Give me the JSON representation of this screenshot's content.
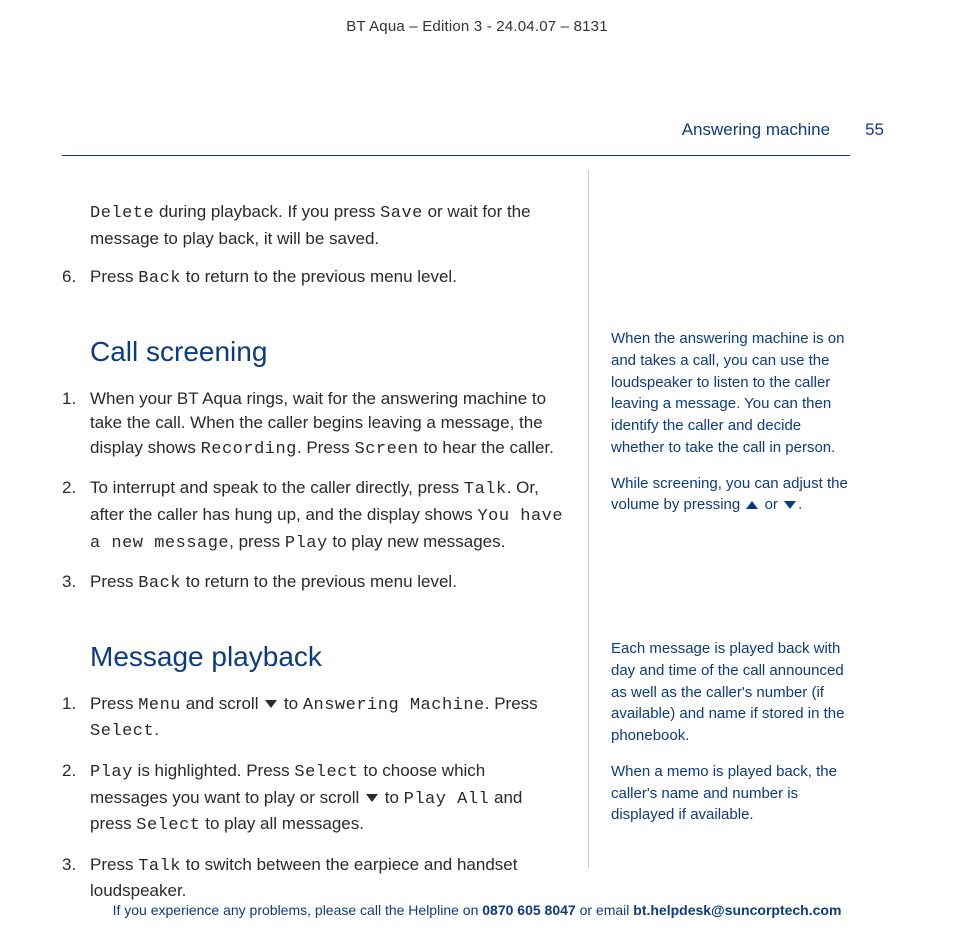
{
  "top_meta": "BT Aqua – Edition 3 -  24.04.07 – 8131",
  "running_head": {
    "section": "Answering machine",
    "page_number": "55"
  },
  "intro": {
    "delete_word": "Delete",
    "p1_rest": " during playback. If you press ",
    "save_word": "Save",
    "p1_tail": " or wait for the message to play back, it will be saved.",
    "step6_num": "6.",
    "step6_a": "Press ",
    "back_word": "Back",
    "step6_b": " to return to the previous menu level."
  },
  "call_screening": {
    "heading": "Call screening",
    "s1": {
      "num": "1.",
      "a": "When your BT Aqua rings, wait for the answering machine to take the call. When the caller begins leaving a message, the display shows ",
      "recording": "Recording",
      "b": ". Press ",
      "screen": "Screen",
      "c": " to hear the caller."
    },
    "s2": {
      "num": "2.",
      "a": "To interrupt and speak to the caller directly, press ",
      "talk": "Talk",
      "b": ". Or, after the caller has hung up, and the display shows ",
      "youhave": "You have a new message",
      "c": ", press ",
      "play": "Play",
      "d": " to play new messages."
    },
    "s3": {
      "num": "3.",
      "a": "Press ",
      "back": "Back",
      "b": " to return to the previous menu level."
    }
  },
  "message_playback": {
    "heading": "Message playback",
    "s1": {
      "num": "1.",
      "a": "Press ",
      "menu": "Menu",
      "b": " and scroll ",
      "c": " to ",
      "ans": "Answering Machine",
      "d": ". Press ",
      "select": "Select",
      "e": "."
    },
    "s2": {
      "num": "2.",
      "play": "Play",
      "a": " is highlighted. Press ",
      "select1": "Select",
      "b": " to choose which messages you want to play or scroll ",
      "c": " to ",
      "playall": "Play All",
      "d": " and press ",
      "select2": "Select",
      "e": " to play all messages."
    },
    "s3": {
      "num": "3.",
      "a": "Press ",
      "talk": "Talk",
      "b": " to switch between the earpiece and handset loudspeaker."
    }
  },
  "sidenotes": {
    "cs1": "When the answering machine is on and takes a call, you can use the loudspeaker to listen to the caller leaving a message. You can then identify the caller and decide whether to take the call in person.",
    "cs2a": "While screening, you can adjust the volume by pressing ",
    "cs2b": " or ",
    "cs2c": ".",
    "mp1": "Each message is played back with day and time of the call announced as well as the caller's number (if available) and name if stored in the phonebook.",
    "mp2": "When a memo is played back, the caller's name and number is displayed if available."
  },
  "footer": {
    "a": "If you experience any problems, please call the Helpline on ",
    "phone": "0870 605 8047",
    "b": " or email ",
    "email": "bt.helpdesk@suncorptech.com"
  }
}
